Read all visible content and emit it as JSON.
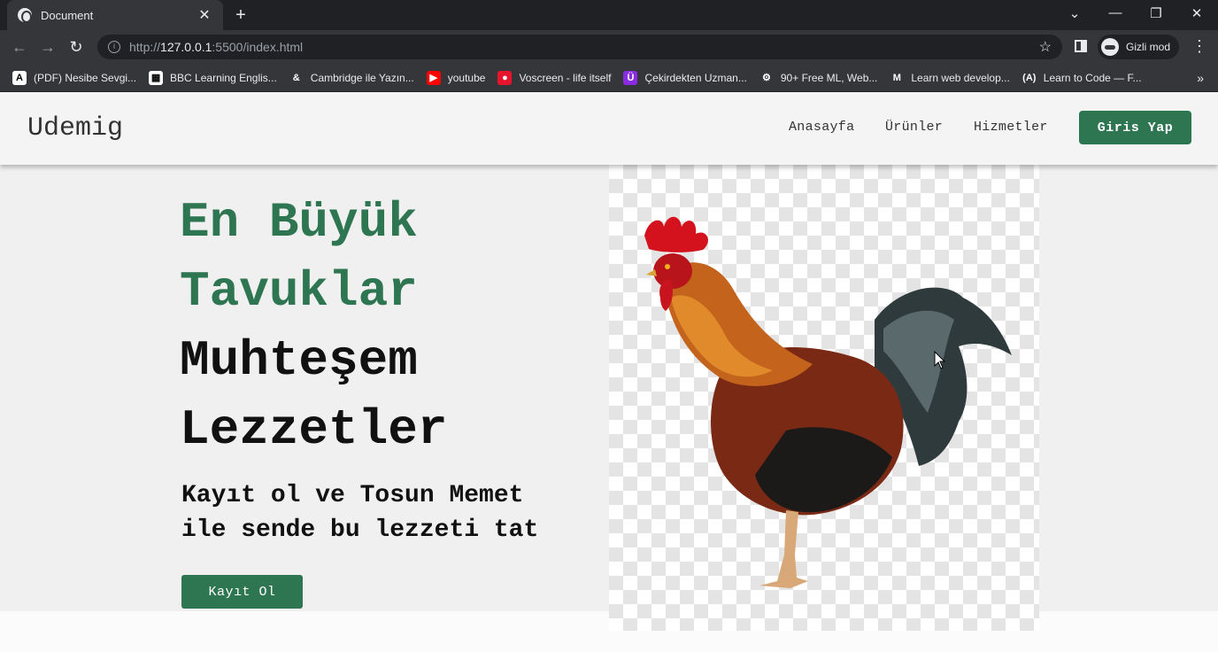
{
  "browser": {
    "tab_title": "Document",
    "url_prefix": "http://",
    "url_host": "127.0.0.1",
    "url_rest": ":5500/index.html",
    "profile_label": "Gizli mod",
    "bookmarks": [
      {
        "label": "(PDF) Nesibe Sevgi...",
        "icon": "academia-icon",
        "color": "#ffffff",
        "glyph": "A"
      },
      {
        "label": "BBC Learning Englis...",
        "icon": "bbc-icon",
        "color": "#ffffff",
        "glyph": "▦"
      },
      {
        "label": "Cambridge ile Yazın...",
        "icon": "cambridge-icon",
        "color": "#35363a",
        "glyph": "&"
      },
      {
        "label": "youtube",
        "icon": "youtube-icon",
        "color": "#ff0000",
        "glyph": "▶"
      },
      {
        "label": "Voscreen - life itself",
        "icon": "voscreen-icon",
        "color": "#e8132c",
        "glyph": "●"
      },
      {
        "label": "Çekirdekten Uzman...",
        "icon": "cekirdek-icon",
        "color": "#8a2be2",
        "glyph": "Ü"
      },
      {
        "label": "90+ Free ML, Web...",
        "icon": "ml-icon",
        "color": "#35363a",
        "glyph": "⚙"
      },
      {
        "label": "Learn web develop...",
        "icon": "mdn-icon",
        "color": "#35363a",
        "glyph": "M"
      },
      {
        "label": "Learn to Code — F...",
        "icon": "freecodecamp-icon",
        "color": "#35363a",
        "glyph": "(A)"
      }
    ],
    "more_bookmarks": "»"
  },
  "site": {
    "brand": "Udemig",
    "nav": [
      "Anasayfa",
      "Ürünler",
      "Hizmetler"
    ],
    "login_button": "Giris Yap",
    "hero": {
      "line1": "En Büyük",
      "line2": "Tavuklar",
      "line3": "Muhteşem",
      "line4": "Lezzetler",
      "sub1": "Kayıt ol ve Tosun Memet",
      "sub2": "ile sende bu lezzeti tat",
      "cta": "Kayıt Ol"
    },
    "colors": {
      "accent": "#2e7651"
    },
    "hero_image": "rooster-image"
  }
}
